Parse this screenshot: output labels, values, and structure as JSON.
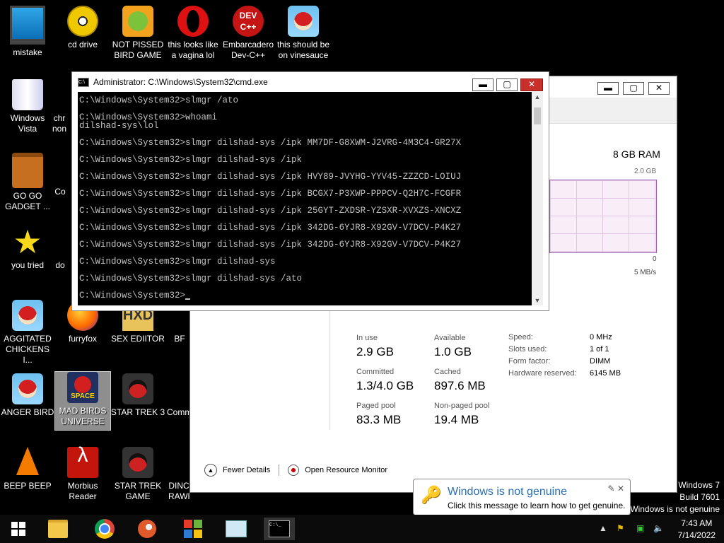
{
  "desktop_icons": [
    {
      "label": "mistake",
      "icon": "monitor-icon"
    },
    {
      "label": "cd drive",
      "icon": "disc-icon"
    },
    {
      "label": "NOT PISSED BIRD GAME",
      "icon": "green-pig-bird-icon"
    },
    {
      "label": "this looks like a vagina lol",
      "icon": "opera-icon"
    },
    {
      "label": "Embarcadero Dev-C++",
      "icon": "devcpp-icon",
      "icon_text": "DEV C++"
    },
    {
      "label": "this should be on vinesauce",
      "icon": "angry-bird-icon"
    },
    {
      "label": "Windows Vista",
      "icon": "recycle-bin-icon"
    },
    {
      "label": "GO GO GADGET ...",
      "icon": "briefcase-icon"
    },
    {
      "label": "you tried",
      "icon": "star-icon"
    },
    {
      "label": "AGGITATED CHICKENS I...",
      "icon": "angry-bird-icon"
    },
    {
      "label": "furryfox",
      "icon": "firefox-icon"
    },
    {
      "label": "SEX EDIITOR",
      "icon": "hex-editor-icon",
      "icon_text": "HXD"
    },
    {
      "label": "ANGER BIRD",
      "icon": "angry-bird-icon"
    },
    {
      "label": "MAD BIRDS UNIVERSE",
      "icon": "angry-birds-space-icon",
      "icon_text": "SPACE"
    },
    {
      "label": "STAR TREK 3",
      "icon": "star-wars-bird-icon"
    },
    {
      "label": "BEEP BEEP",
      "icon": "vlc-cone-icon"
    },
    {
      "label": "Morbius Reader",
      "icon": "acrobat-reader-icon"
    },
    {
      "label": "STAR TREK GAME",
      "icon": "star-wars-bird-icon"
    },
    {
      "label": "chr",
      "icon": "chrome-icon"
    },
    {
      "label": "non",
      "icon": "chrome-icon"
    },
    {
      "label": "Co",
      "icon": "app-icon"
    },
    {
      "label": "do",
      "icon": "app-icon"
    },
    {
      "label": "BF",
      "icon": "app-icon"
    },
    {
      "label": "Comm",
      "icon": "app-icon"
    },
    {
      "label": "DINC",
      "icon": "app-icon"
    },
    {
      "label": "RAWR",
      "icon": "app-icon"
    }
  ],
  "cmd": {
    "title": "Administrator: C:\\Windows\\System32\\cmd.exe",
    "icon_text": "C:\\",
    "lines": [
      "C:\\Windows\\System32>slmgr /ato",
      "",
      "C:\\Windows\\System32>whoami",
      "dilshad-sys\\lol",
      "",
      "C:\\Windows\\System32>slmgr dilshad-sys /ipk MM7DF-G8XWM-J2VRG-4M3C4-GR27X",
      "",
      "C:\\Windows\\System32>slmgr dilshad-sys /ipk",
      "",
      "C:\\Windows\\System32>slmgr dilshad-sys /ipk HVY89-JVYHG-YYV45-ZZZCD-LOIUJ",
      "",
      "C:\\Windows\\System32>slmgr dilshad-sys /ipk BCGX7-P3XWP-PPPCV-Q2H7C-FCGFR",
      "",
      "C:\\Windows\\System32>slmgr dilshad-sys /ipk 25GYT-ZXDSR-YZSXR-XVXZS-XNCXZ",
      "",
      "C:\\Windows\\System32>slmgr dilshad-sys /ipk 342DG-6YJR8-X92GV-V7DCV-P4K27",
      "",
      "C:\\Windows\\System32>slmgr dilshad-sys /ipk 342DG-6YJR8-X92GV-V7DCV-P4K27",
      "",
      "C:\\Windows\\System32>slmgr dilshad-sys",
      "",
      "C:\\Windows\\System32>slmgr dilshad-sys /ato",
      "",
      "C:\\Windows\\System32>"
    ]
  },
  "taskmgr": {
    "ram_total": "8 GB RAM",
    "graph_max": "2.0 GB",
    "graph_min": "0",
    "rate": "5 MB/s",
    "stats": {
      "in_use_label": "In use",
      "in_use": "2.9 GB",
      "available_label": "Available",
      "available": "1.0 GB",
      "committed_label": "Committed",
      "committed": "1.3/4.0 GB",
      "cached_label": "Cached",
      "cached": "897.6 MB",
      "paged_label": "Paged pool",
      "paged": "83.3 MB",
      "nonpaged_label": "Non-paged pool",
      "nonpaged": "19.4 MB"
    },
    "specs": {
      "speed_label": "Speed:",
      "speed": "0 MHz",
      "slots_label": "Slots used:",
      "slots": "1 of 1",
      "form_label": "Form factor:",
      "form": "DIMM",
      "hw_label": "Hardware reserved:",
      "hw": "6145 MB"
    },
    "fewer_details": "Fewer Details",
    "open_resmon": "Open Resource Monitor"
  },
  "balloon": {
    "title": "Windows is not genuine",
    "message": "Click this message to learn how to get genuine."
  },
  "watermark": {
    "line1": "Windows 7",
    "line2": "Build 7601",
    "line3": "Windows is not genuine"
  },
  "window_controls": {
    "minimize": "▬",
    "maximize": "▢",
    "close": "✕"
  },
  "taskbar": {
    "time": "7:43 AM",
    "date": "7/14/2022",
    "cmd_icon_text": "C:\\_",
    "winlogo_colors": [
      "#e53b2b",
      "#6ab43e",
      "#2e7bd3",
      "#f4c415"
    ]
  }
}
